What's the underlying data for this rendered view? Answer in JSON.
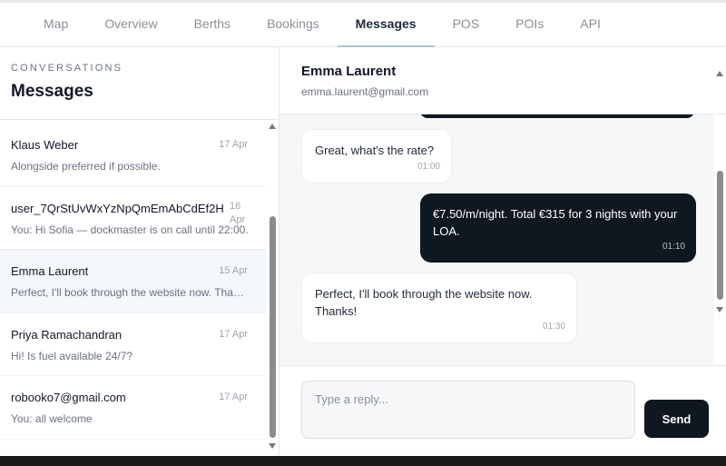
{
  "nav": {
    "tabs": [
      "Map",
      "Overview",
      "Berths",
      "Bookings",
      "Messages",
      "POS",
      "POIs",
      "API"
    ],
    "active": "Messages"
  },
  "sidebar": {
    "kicker": "CONVERSATIONS",
    "title": "Messages",
    "conversations": [
      {
        "name": "Klaus Weber",
        "date": "17 Apr",
        "preview": "Alongside preferred if possible."
      },
      {
        "name": "user_7QrStUvWxYzNpQmEmAbCdEf2H",
        "date": "16 Apr",
        "preview": "You: Hi Sofia — dockmaster is on call until 22:00."
      },
      {
        "name": "Emma Laurent",
        "date": "15 Apr",
        "preview": "Perfect, I'll book through the website now. Thanks!"
      },
      {
        "name": "Priya Ramachandran",
        "date": "17 Apr",
        "preview": "Hi! Is fuel available 24/7?"
      },
      {
        "name": "robooko7@gmail.com",
        "date": "17 Apr",
        "preview": "You: all welcome"
      }
    ]
  },
  "chat": {
    "contact_name": "Emma Laurent",
    "contact_email": "emma.laurent@gmail.com",
    "messages": [
      {
        "direction": "in",
        "text": "Great, what's the rate?",
        "time": "01:00"
      },
      {
        "direction": "out",
        "text": "€7.50/m/night. Total €315 for 3 nights with your LOA.",
        "time": "01:10"
      },
      {
        "direction": "in",
        "text": "Perfect, I'll book through the website now. Thanks!",
        "time": "01:30"
      }
    ]
  },
  "composer": {
    "placeholder": "Type a reply...",
    "send_label": "Send"
  }
}
